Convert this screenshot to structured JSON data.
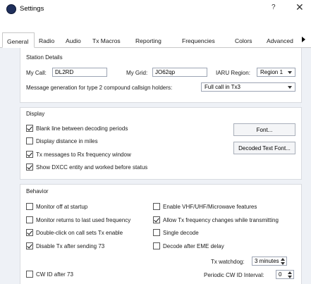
{
  "window": {
    "title": "Settings",
    "help_label": "?",
    "close_label": "✕"
  },
  "tabs": [
    {
      "label": "General"
    },
    {
      "label": "Radio"
    },
    {
      "label": "Audio"
    },
    {
      "label": "Tx Macros"
    },
    {
      "label": "Reporting"
    },
    {
      "label": "Frequencies"
    },
    {
      "label": "Colors"
    },
    {
      "label": "Advanced"
    }
  ],
  "active_tab": "General",
  "station": {
    "title": "Station Details",
    "my_call_label": "My Call:",
    "my_call_value": "DL2RD",
    "my_grid_label": "My Grid:",
    "my_grid_value": "JO62qp",
    "iaru_label": "IARU Region:",
    "iaru_value": "Region 1",
    "compound_label": "Message generation for type 2 compound callsign holders:",
    "compound_value": "Full call in Tx3"
  },
  "display": {
    "title": "Display",
    "blank_line": {
      "label": "Blank line between decoding periods",
      "checked": true
    },
    "distance_miles": {
      "label": "Display distance in miles",
      "checked": false
    },
    "tx_rx_window": {
      "label": "Tx messages to Rx frequency window",
      "checked": true
    },
    "dxcc": {
      "label": "Show DXCC entity and worked before status",
      "checked": true
    },
    "font_button": "Font...",
    "decoded_font_button": "Decoded Text Font..."
  },
  "behavior": {
    "title": "Behavior",
    "monitor_off": {
      "label": "Monitor off at startup",
      "checked": false
    },
    "monitor_returns": {
      "label": "Monitor returns to last used frequency",
      "checked": false
    },
    "double_click": {
      "label": "Double-click on call sets Tx enable",
      "checked": true
    },
    "disable_tx": {
      "label": "Disable Tx after sending 73",
      "checked": true
    },
    "cw_id": {
      "label": "CW ID after 73",
      "checked": false
    },
    "vhf_features": {
      "label": "Enable VHF/UHF/Microwave features",
      "checked": false
    },
    "allow_tx_change": {
      "label": "Allow Tx frequency changes while transmitting",
      "checked": true
    },
    "single_decode": {
      "label": "Single decode",
      "checked": false
    },
    "decode_eme": {
      "label": "Decode after EME delay",
      "checked": false
    },
    "tx_watchdog_label": "Tx watchdog:",
    "tx_watchdog_value": "3 minutes",
    "periodic_cw_label": "Periodic CW ID Interval:",
    "periodic_cw_value": "0"
  }
}
